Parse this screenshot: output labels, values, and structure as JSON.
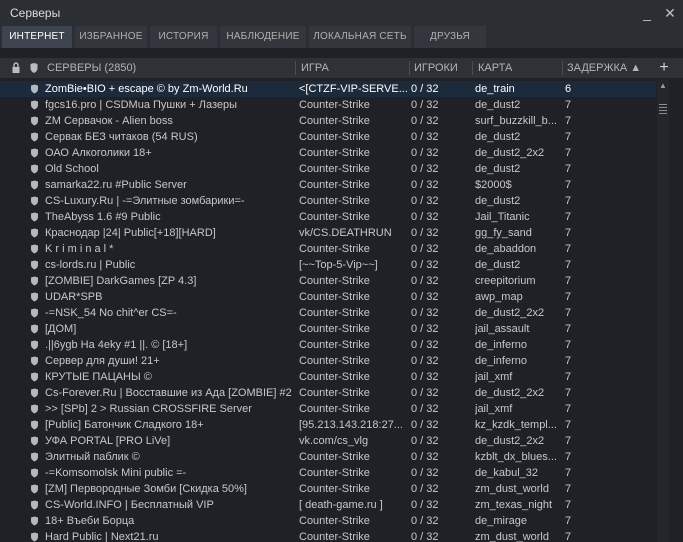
{
  "window": {
    "title": "Серверы",
    "minimize_label": "_",
    "close_label": "✕"
  },
  "tabs": [
    {
      "label": "ИНТЕРНЕТ",
      "active": true
    },
    {
      "label": "ИЗБРАННОЕ",
      "active": false
    },
    {
      "label": "ИСТОРИЯ",
      "active": false
    },
    {
      "label": "НАБЛЮДЕНИЕ",
      "active": false
    },
    {
      "label": "ЛОКАЛЬНАЯ СЕТЬ",
      "active": false
    },
    {
      "label": "ДРУЗЬЯ",
      "active": false
    }
  ],
  "table": {
    "headers": {
      "servers": "СЕРВЕРЫ (2850)",
      "game": "ИГРА",
      "players": "ИГРОКИ",
      "map": "КАРТА",
      "latency": "ЗАДЕРЖКА ▲"
    },
    "add_label": "+",
    "rows": [
      {
        "name": "  ZomBie•BIO + escape © by Zm-World.Ru",
        "game": "<[CTZF-VIP-SERVE...",
        "players": "0 / 32",
        "map": "de_train",
        "latency": "6",
        "selected": true
      },
      {
        "name": "fgcs16.pro | CSDMua Пушки + Лазеры",
        "game": "Counter-Strike",
        "players": "0 / 32",
        "map": "de_dust2",
        "latency": "7",
        "selected": false
      },
      {
        "name": "ZM Сервачок - Alien boss",
        "game": "Counter-Strike",
        "players": "0 / 32",
        "map": "surf_buzzkill_b...",
        "latency": "7",
        "selected": false
      },
      {
        "name": "Сервак БЕЗ читаков (54 RUS)",
        "game": "Counter-Strike",
        "players": "0 / 32",
        "map": "de_dust2",
        "latency": "7",
        "selected": false
      },
      {
        "name": "ОАО Алкоголики 18+",
        "game": "Counter-Strike",
        "players": "0 / 32",
        "map": "de_dust2_2x2",
        "latency": "7",
        "selected": false
      },
      {
        "name": "Old School",
        "game": "Counter-Strike",
        "players": "0 / 32",
        "map": "de_dust2",
        "latency": "7",
        "selected": false
      },
      {
        "name": "samarka22.ru #Public Server",
        "game": "Counter-Strike",
        "players": "0 / 32",
        "map": "$2000$",
        "latency": "7",
        "selected": false
      },
      {
        "name": "CS-Luxury.Ru | -=Элитные зомбарики=-",
        "game": "Counter-Strike",
        "players": "0 / 32",
        "map": "de_dust2",
        "latency": "7",
        "selected": false
      },
      {
        "name": "TheAbyss 1.6 #9 Public",
        "game": "Counter-Strike",
        "players": "0 / 32",
        "map": "Jail_Titanic",
        "latency": "7",
        "selected": false
      },
      {
        "name": "Краснодар |24| Public[+18][HARD]",
        "game": "vk/CS.DEATHRUN",
        "players": "0 / 32",
        "map": "gg_fy_sand",
        "latency": "7",
        "selected": false
      },
      {
        "name": "K r i m i n a l *",
        "game": "Counter-Strike",
        "players": "0 / 32",
        "map": "de_abaddon",
        "latency": "7",
        "selected": false
      },
      {
        "name": "cs-lords.ru | Public",
        "game": "[~~Top-5-Vip~~]",
        "players": "0 / 32",
        "map": "de_dust2",
        "latency": "7",
        "selected": false
      },
      {
        "name": " [ZOMBIE] DarkGames [ZP 4.3]",
        "game": "Counter-Strike",
        "players": "0 / 32",
        "map": "creepitorium",
        "latency": "7",
        "selected": false
      },
      {
        "name": "UDAR*SPB",
        "game": "Counter-Strike",
        "players": "0 / 32",
        "map": "awp_map",
        "latency": "7",
        "selected": false
      },
      {
        "name": "-=NSK_54 No chit^er CS=-",
        "game": "Counter-Strike",
        "players": "0 / 32",
        "map": "de_dust2_2x2",
        "latency": "7",
        "selected": false
      },
      {
        "name": "[ДОМ]",
        "game": "Counter-Strike",
        "players": "0 / 32",
        "map": "jail_assault",
        "latency": "7",
        "selected": false
      },
      {
        "name": ".||6ygb На 4eky #1 ||. © [18+]",
        "game": "Counter-Strike",
        "players": "0 / 32",
        "map": "de_inferno",
        "latency": "7",
        "selected": false
      },
      {
        "name": "Сервер для души! 21+",
        "game": "Counter-Strike",
        "players": "0 / 32",
        "map": "de_inferno",
        "latency": "7",
        "selected": false
      },
      {
        "name": "КРУТЫЕ ПАЦАНЫ ©",
        "game": "Counter-Strike",
        "players": "0 / 32",
        "map": "jail_xmf",
        "latency": "7",
        "selected": false
      },
      {
        "name": "Cs-Forever.Ru | Восставшие из Ада [ZOMBIE] #2",
        "game": "Counter-Strike",
        "players": "0 / 32",
        "map": "de_dust2_2x2",
        "latency": "7",
        "selected": false
      },
      {
        "name": ">> [SPb] 2 > Russian CROSSFIRE Server",
        "game": "Counter-Strike",
        "players": "0 / 32",
        "map": "jail_xmf",
        "latency": "7",
        "selected": false
      },
      {
        "name": "[Public] Батончик Сладкого 18+",
        "game": "[95.213.143.218:27...",
        "players": "0 / 32",
        "map": "kz_kzdk_templ...",
        "latency": "7",
        "selected": false
      },
      {
        "name": "  УФА PORTAL [PRO LiVe]",
        "game": "vk.com/cs_vlg",
        "players": "0 / 32",
        "map": "de_dust2_2x2",
        "latency": "7",
        "selected": false
      },
      {
        "name": "Элитный паблик ©",
        "game": "Counter-Strike",
        "players": "0 / 32",
        "map": "kzblt_dx_blues...",
        "latency": "7",
        "selected": false
      },
      {
        "name": "-=Komsomolsk Mini public =-",
        "game": "Counter-Strike",
        "players": "0 / 32",
        "map": "de_kabul_32",
        "latency": "7",
        "selected": false
      },
      {
        "name": "[ZM] Первородные Зомби [Скидка 50%]",
        "game": "Counter-Strike",
        "players": "0 / 32",
        "map": "zm_dust_world",
        "latency": "7",
        "selected": false
      },
      {
        "name": "CS-World.INFO | Бесплатный VIP",
        "game": "[ death-game.ru ]",
        "players": "0 / 32",
        "map": "zm_texas_night",
        "latency": "7",
        "selected": false
      },
      {
        "name": "18+ Въеби Борца",
        "game": "Counter-Strike",
        "players": "0 / 32",
        "map": " de_mirage",
        "latency": "7",
        "selected": false
      },
      {
        "name": "Hard Public | Next21.ru",
        "game": "Counter-Strike",
        "players": "0 / 32",
        "map": "zm_dust_world",
        "latency": "7",
        "selected": false
      }
    ]
  },
  "colors": {
    "background": "#1f2126",
    "titlebar": "#2b2e33",
    "tab_active": "#3d4450",
    "selected_row": "#1c2a3b",
    "text": "#c8c8c8"
  },
  "icons": [
    "lock-icon",
    "shield-icon",
    "favorite-shield-icon"
  ]
}
